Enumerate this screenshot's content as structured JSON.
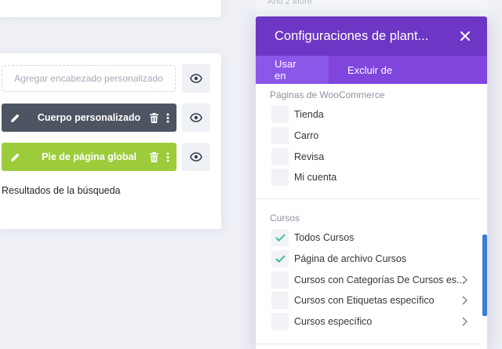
{
  "template_layouts": {
    "header_placeholder": "Agregar encabezado personalizado",
    "body_label": "Cuerpo personalizado",
    "footer_label": "Pie de página global",
    "template_name": "Resultados de la búsqueda",
    "body_color": "#4d5562",
    "footer_color": "#9ccc3a"
  },
  "sidebar": {
    "and_more": "And 2 More"
  },
  "modal": {
    "title": "Configuraciones de plant...",
    "header_color": "#6d36c4",
    "tabs": [
      {
        "label": "Usar en",
        "active": true
      },
      {
        "label": "Excluir de",
        "active": false
      }
    ],
    "sections": [
      {
        "title": "Páginas de WooCommerce",
        "items": [
          {
            "label": "Tienda",
            "checked": false
          },
          {
            "label": "Carro",
            "checked": false
          },
          {
            "label": "Revisa",
            "checked": false
          },
          {
            "label": "Mi cuenta",
            "checked": false
          }
        ]
      },
      {
        "title": "Cursos",
        "items": [
          {
            "label": "Todos Cursos",
            "checked": true
          },
          {
            "label": "Página de archivo Cursos",
            "checked": true
          },
          {
            "label": "Cursos con Categorías De Cursos es...",
            "checked": false,
            "expandable": true
          },
          {
            "label": "Cursos con Etiquetas específico",
            "checked": false,
            "expandable": true
          },
          {
            "label": "Cursos específico",
            "checked": false,
            "expandable": true
          }
        ]
      }
    ],
    "check_color": "#3ebea0",
    "scrollbar_color": "#3a7fd1"
  }
}
